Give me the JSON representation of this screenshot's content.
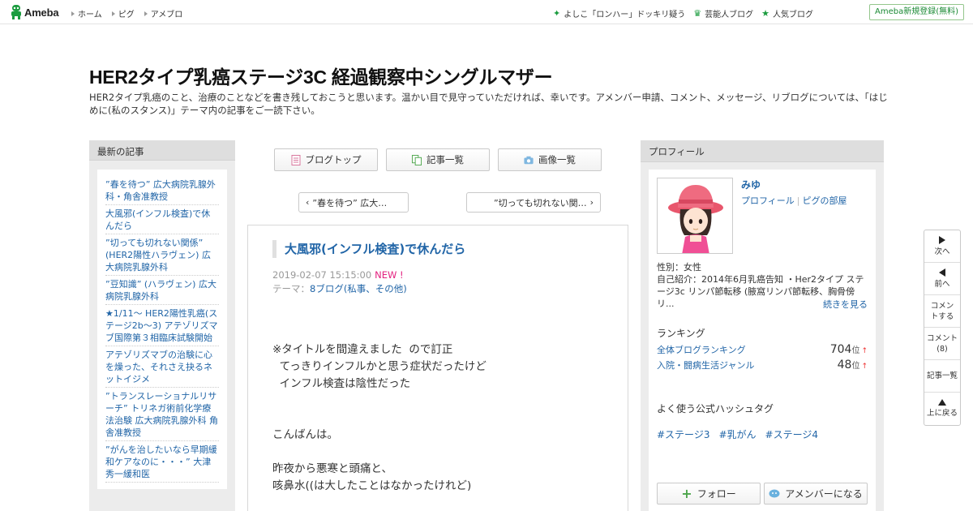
{
  "header": {
    "logo": "Ameba",
    "nav": [
      "ホーム",
      "ピグ",
      "アメブロ"
    ],
    "right_links": [
      {
        "icon": "sparkle-icon",
        "label": "よしこ「ロンハー」ドッキリ疑う"
      },
      {
        "icon": "crown-icon",
        "label": "芸能人ブログ"
      },
      {
        "icon": "star-icon",
        "label": "人気ブログ"
      }
    ],
    "register": "Ameba新規登録(無料)"
  },
  "blog": {
    "title": "HER2タイプ乳癌ステージ3C 経過観察中シングルマザー",
    "description": "HER2タイプ乳癌のこと、治療のことなどを書き残しておこうと思います。温かい目で見守っていただければ、幸いです。アメンバー申請、コメント、メッセージ、リブログについては、「はじめに(私のスタンス)」テーマ内の記事をご一読下さい。"
  },
  "left_sidebar": {
    "heading": "最新の記事",
    "items": [
      "”春を待つ” 広大病院乳腺外科・角舎准教授",
      "大風邪(インフル検査)で休んだら",
      "”切っても切れない関係” (HER2陽性ハラヴェン) 広大病院乳腺外科",
      "”豆知識” (ハラヴェン) 広大病院乳腺外科",
      "★1/11～ HER2陽性乳癌(ステージ2b～3) アテゾリズマブ国際第３相臨床試験開始",
      "アテゾリズマブの治験に心を燥った、それさえ抉るネットイジメ",
      "”トランスレーショナルリサーチ” トリネガ術前化学療法治験 広大病院乳腺外科 角舎准教授",
      "”がんを治したいなら早期緩和ケアなのに・・・” 大津秀一緩和医"
    ]
  },
  "center": {
    "tabs": [
      {
        "icon": "document-icon",
        "label": "ブログトップ"
      },
      {
        "icon": "copy-icon",
        "label": "記事一覧"
      },
      {
        "icon": "camera-icon",
        "label": "画像一覧"
      }
    ],
    "prev_entry": "”春を待つ” 広大…",
    "next_entry": "”切っても切れない関…",
    "entry": {
      "title": "大風邪(インフル検査)で休んだら",
      "datetime": "2019-02-07 15:15:00",
      "new_badge": "NEW !",
      "theme_label": "テーマ：",
      "theme": "8ブログ(私事、その他)",
      "body": "※タイトルを間違えました  ので訂正\n  てっきりインフルかと思う症状だったけど\n  インフル検査は陰性だった\n\n\nこんばんは。\n\n昨夜から悪寒と頭痛と、\n咳鼻水((は大したことはなかったけれど)"
    }
  },
  "right_sidebar": {
    "heading": "プロフィール",
    "name": "みゆ",
    "link_profile": "プロフィール",
    "link_pig": "ピグの部屋",
    "gender": "性別：女性",
    "intro": "自己紹介：2014年6月乳癌告知 ・Her2タイプ ステージ3c リンパ節転移 (腋窩リンパ節転移、胸骨傍リ...",
    "more": "続きを見る",
    "ranking_heading": "ランキング",
    "rankings": [
      {
        "label": "全体ブログランキング",
        "value": "704",
        "unit": "位",
        "trend": "↑"
      },
      {
        "label": "入院・闘病生活ジャンル",
        "value": "48",
        "unit": "位",
        "trend": "↑"
      }
    ],
    "hashtag_heading": "よく使う公式ハッシュタグ",
    "hashtags": [
      "#ステージ3",
      "#乳がん",
      "#ステージ4"
    ],
    "follow": "フォロー",
    "amember": "アメンバーになる"
  },
  "float_nav": [
    {
      "icon": "next-arrow-icon",
      "label": "次へ"
    },
    {
      "icon": "prev-arrow-icon",
      "label": "前へ"
    },
    {
      "icon": "",
      "label": "コメントする"
    },
    {
      "icon": "",
      "label": "コメント(8)"
    },
    {
      "icon": "",
      "label": "記事一覧"
    },
    {
      "icon": "up-arrow-icon",
      "label": "上に戻る"
    }
  ]
}
